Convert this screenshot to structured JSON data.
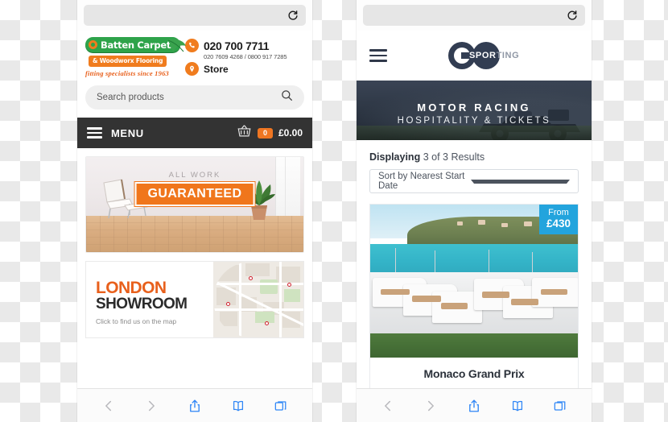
{
  "left_phone": {
    "browser": {
      "url_value": "",
      "url_placeholder": "",
      "reload_icon": "reload-icon",
      "toolbar": {
        "back": "back-icon",
        "forward": "forward-icon",
        "share": "share-icon",
        "bookmarks": "bookmarks-icon",
        "tabs": "tabs-icon"
      }
    },
    "brand": {
      "name": "Batten Carpets",
      "sub": "& Woodworx Flooring",
      "tagline": "fitting specialists since 1963",
      "leaf_icon": "leaf-icon"
    },
    "contact": {
      "phone_primary": "020 700 7711",
      "phone_secondary": "020 7609 4268 / 0800 917 7285",
      "store_label": "Store",
      "phone_icon": "phone-icon",
      "pin_icon": "map-pin-icon"
    },
    "search": {
      "placeholder": "Search products",
      "value": "",
      "icon": "search-icon"
    },
    "menubar": {
      "menu_label": "MENU",
      "burger_icon": "hamburger-icon",
      "basket_icon": "basket-icon",
      "cart_count": "0",
      "cart_total": "£0.00",
      "bg_color": "#333333",
      "accent_color": "#ef7622"
    },
    "hero": {
      "eyebrow": "ALL WORK",
      "headline": "GUARANTEED",
      "badge_color": "#f0761c"
    },
    "showroom": {
      "city": "LONDON",
      "word": "SHOWROOM",
      "cta": "Click to find us on the map",
      "city_color": "#e8601c"
    }
  },
  "right_phone": {
    "browser": {
      "url_value": "",
      "url_placeholder": "",
      "reload_icon": "reload-icon",
      "toolbar": {
        "back": "back-icon",
        "forward": "forward-icon",
        "share": "share-icon",
        "bookmarks": "bookmarks-icon",
        "tabs": "tabs-icon"
      }
    },
    "brand": {
      "logo_g": "GO",
      "logo_word_white": "SPOR",
      "logo_word_gray": "TING",
      "burger_icon": "hamburger-icon",
      "logo_color": "#323d52"
    },
    "banner": {
      "line1": "MOTOR RACING",
      "line2": "HOSPITALITY & TICKETS"
    },
    "results": {
      "label_bold": "Displaying",
      "label_rest": " 3 of 3 Results",
      "sort_value": "Sort by Nearest Start Date",
      "caret_icon": "chevron-down-icon"
    },
    "card": {
      "price_from": "From",
      "price_value": "£430",
      "price_bg": "#23a4dd",
      "title": "Monaco Grand Prix"
    }
  }
}
